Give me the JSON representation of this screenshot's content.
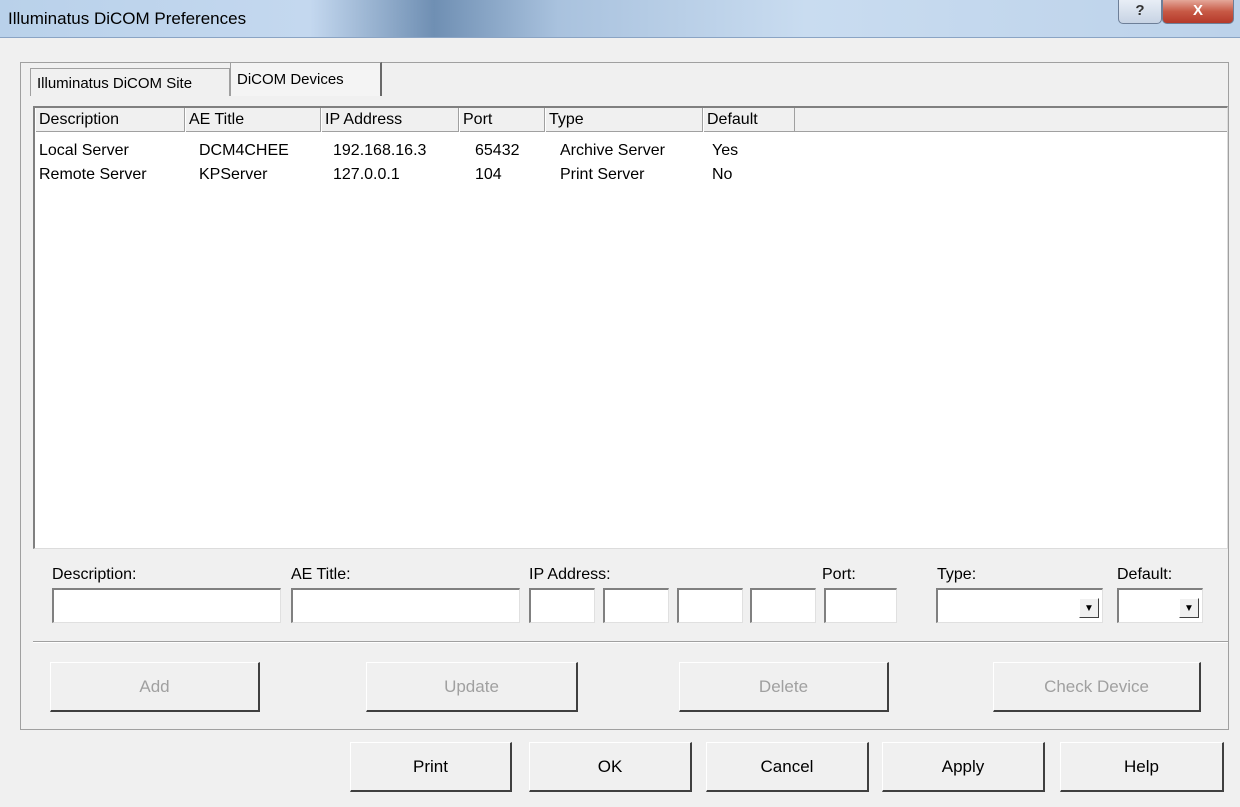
{
  "window": {
    "title": "Illuminatus DiCOM Preferences",
    "help_glyph": "?",
    "close_glyph": "X"
  },
  "tabs": [
    {
      "label": "Illuminatus DiCOM Site",
      "selected": false
    },
    {
      "label": "DiCOM Devices",
      "selected": true
    }
  ],
  "device_list": {
    "columns": [
      "Description",
      "AE Title",
      "IP Address",
      "Port",
      "Type",
      "Default"
    ],
    "rows": [
      [
        "Local Server",
        "DCM4CHEE",
        "192.168.16.3",
        "65432",
        "Archive Server",
        "Yes"
      ],
      [
        "Remote Server",
        "KPServer",
        "127.0.0.1",
        "104",
        "Print Server",
        "No"
      ]
    ]
  },
  "form": {
    "description_label": "Description:",
    "ae_title_label": "AE Title:",
    "ip_address_label": "IP Address:",
    "port_label": "Port:",
    "type_label": "Type:",
    "default_label": "Default:",
    "description_value": "",
    "ae_title_value": "",
    "ip_octets": [
      "",
      "",
      "",
      ""
    ],
    "port_value": "",
    "type_value": "",
    "default_value": "",
    "dropdown_glyph": "▼"
  },
  "action_buttons": {
    "add": "Add",
    "update": "Update",
    "delete": "Delete",
    "check_device": "Check Device"
  },
  "dialog_buttons": {
    "print": "Print",
    "ok": "OK",
    "cancel": "Cancel",
    "apply": "Apply",
    "help": "Help"
  }
}
